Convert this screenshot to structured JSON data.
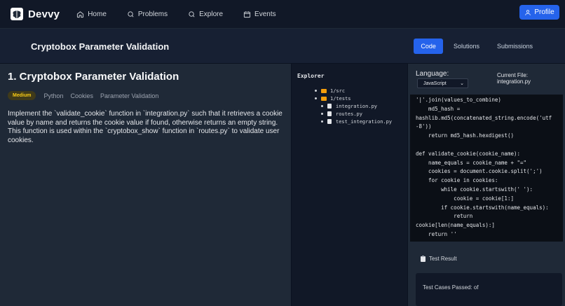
{
  "nav": {
    "brand": "Devvy",
    "links": [
      {
        "label": "Home",
        "icon": "home-icon"
      },
      {
        "label": "Problems",
        "icon": "search-icon"
      },
      {
        "label": "Explore",
        "icon": "search-icon"
      },
      {
        "label": "Events",
        "icon": "calendar-icon"
      }
    ],
    "profile_label": "Profile"
  },
  "header": {
    "title": "Cryptobox Parameter Validation",
    "tabs": [
      "Code",
      "Solutions",
      "Submissions"
    ],
    "active_tab": "Code"
  },
  "problem": {
    "title": "1. Cryptobox Parameter Validation",
    "difficulty": "Medium",
    "tags": [
      "Python",
      "Cookies",
      "Parameter Validation"
    ],
    "description": "Implement the `validate_cookie` function in `integration.py` such that it retrieves a cookie value by name and returns the cookie value if found, otherwise returns an empty string. This function is used within the `cryptobox_show` function in `routes.py` to validate user cookies."
  },
  "explorer": {
    "title": "Explorer",
    "folders": [
      "1/src",
      "1/tests"
    ],
    "files": [
      "integration.py",
      "routes.py",
      "test_integration.py"
    ]
  },
  "editor": {
    "language_label": "Language:",
    "language_value": "JavaScript",
    "current_file_label": "Current File:",
    "current_file": "integration.py",
    "code": "'|'.join(values_to_combine)\n    md5_hash =\nhashlib.md5(concatenated_string.encode('utf\n-8'))\n    return md5_hash.hexdigest()\n\ndef validate_cookie(cookie_name):\n    name_equals = cookie_name + \"=\"\n    cookies = document.cookie.split(';')\n    for cookie in cookies:\n        while cookie.startswith(' '):\n            cookie = cookie[1:]\n        if cookie.startswith(name_equals):\n            return\ncookie[len(name_equals):]\n    return ''"
  },
  "result": {
    "title": "Test Result",
    "summary": "Test Cases Passed: of"
  },
  "colors": {
    "accent": "#2563eb",
    "difficulty_medium": "#facc15",
    "folder": "#f59e0b"
  }
}
